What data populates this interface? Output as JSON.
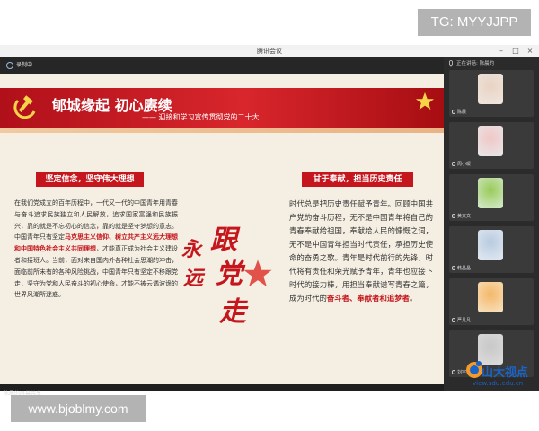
{
  "watermarks": {
    "top": "TG: MYYJJPP",
    "bottom": "www.bjoblmy.com"
  },
  "window": {
    "title": "腾讯会议",
    "recording_label": "录制中",
    "share_label": "陈晨的屏幕共享"
  },
  "slide": {
    "banner_title": "郇城缘起 初心赓续",
    "banner_subtitle": "—— 迎接和学习宣传贯彻党的二十大",
    "left_tag": "坚定信念，坚守伟大理想",
    "right_tag": "甘于奉献，担当历史责任",
    "left_paragraph_before": "在我们党成立的百年历程中，一代又一代的中国青年用青春与奋斗追求民族独立和人民解放，追求国家富强和民族振兴，靠的就是不忘初心的信念，靠的就是坚守梦想的意志。中国青年只有坚定",
    "left_highlight": "马克思主义信仰、树立共产主义远大理想和中国特色社会主义共同理想",
    "left_paragraph_after": "，才能真正成为社会主义建设者和接班人。当前，面对来自国内外各种社会思潮的冲击，面临前所未有的各种风险挑战，中国青年只有坚定不移跟党走，坚守为党和人民奋斗的初心使命，才能不被云谲波诡的世界风潮所迷惑。",
    "calligraphy": {
      "yong": "永",
      "yuan": "远",
      "gen": "跟",
      "dang": "党",
      "zou": "走"
    },
    "right_paragraph_before": "时代总是把历史责任赋予青年。回顾中国共产党的奋斗历程，无不是中国青年将自己的青春奉献给祖国，奉献给人民的慷慨之词，无不是中国青年担当时代责任，承担历史使命的奋勇之歌。青年是时代前行的先锋，时代将有责任和荣光赋予青年，青年也应接下时代的接力棒，用担当奉献谱写青春之篇，成为时代的",
    "right_highlight": "奋斗者、奉献者和追梦者",
    "right_paragraph_after": "。"
  },
  "sidebar": {
    "speaking_label": "正在讲话: 陈晨的",
    "participants": [
      {
        "name": "陈晨",
        "avatar_color": "#e8d3c4",
        "accent": "#f0e6de"
      },
      {
        "name": "周小暖",
        "avatar_color": "#f1c7c7",
        "accent": "#e8e8e8"
      },
      {
        "name": "黄文文",
        "avatar_color": "#9acb5a",
        "accent": "#d6ead0"
      },
      {
        "name": "韩晶晶",
        "avatar_color": "#b9cbe0",
        "accent": "#e3eaf2"
      },
      {
        "name": "严凡凡",
        "avatar_color": "#f4b86a",
        "accent": "#f7e3c0"
      },
      {
        "name": "刘宇",
        "avatar_color": "#c8c8c8",
        "accent": "#dcdcdc"
      }
    ]
  },
  "logo": {
    "name": "山大视点",
    "url": "view.sdu.edu.cn"
  },
  "colors": {
    "party_red": "#c4161c",
    "banner_dark": "#a60d12",
    "slide_bg": "#f5efe3",
    "logo_blue": "#1a64c8"
  }
}
